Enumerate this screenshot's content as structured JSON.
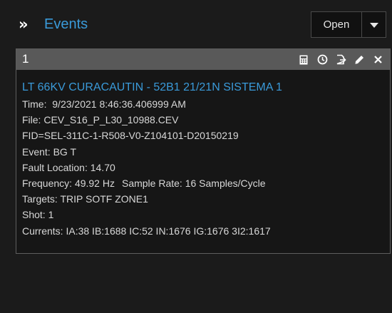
{
  "header": {
    "title": "Events",
    "open_label": "Open"
  },
  "card": {
    "number": "1",
    "event_title": "LT 66KV CURACAUTIN - 52B1 21/21N SISTEMA 1",
    "time_label": "Time:",
    "time_value": "9/23/2021 8:46:36.406999 AM",
    "file_label": "File:",
    "file_value": "CEV_S16_P_L30_10988.CEV",
    "fid": "FID=SEL-311C-1-R508-V0-Z104101-D20150219",
    "event_label": "Event:",
    "event_value": "BG T",
    "fault_location_label": "Fault Location:",
    "fault_location_value": "14.70",
    "frequency_label": "Frequency:",
    "frequency_value": "49.92 Hz",
    "sample_rate_label": "Sample Rate:",
    "sample_rate_value": "16 Samples/Cycle",
    "targets_label": "Targets:",
    "targets_value": "TRIP SOTF ZONE1",
    "shot_label": "Shot:",
    "shot_value": "1",
    "currents_label": "Currents:",
    "currents_value": "IA:38 IB:1688 IC:52 IN:1676 IG:1676 3I2:1617"
  },
  "toolbar_icons": [
    "calculator-icon",
    "clock-icon",
    "export-icon",
    "edit-icon",
    "close-icon"
  ],
  "colors": {
    "accent": "#3a9ad9",
    "background": "#1b1b1b",
    "card_header": "#595959"
  }
}
